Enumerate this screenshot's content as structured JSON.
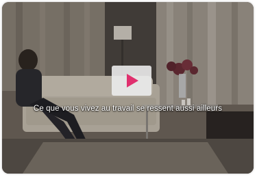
{
  "video": {
    "caption": "Ce que vous vivez au travail se ressent aussi ailleurs",
    "play_button_icon": "play-icon",
    "accent_color": "#e0306e"
  }
}
